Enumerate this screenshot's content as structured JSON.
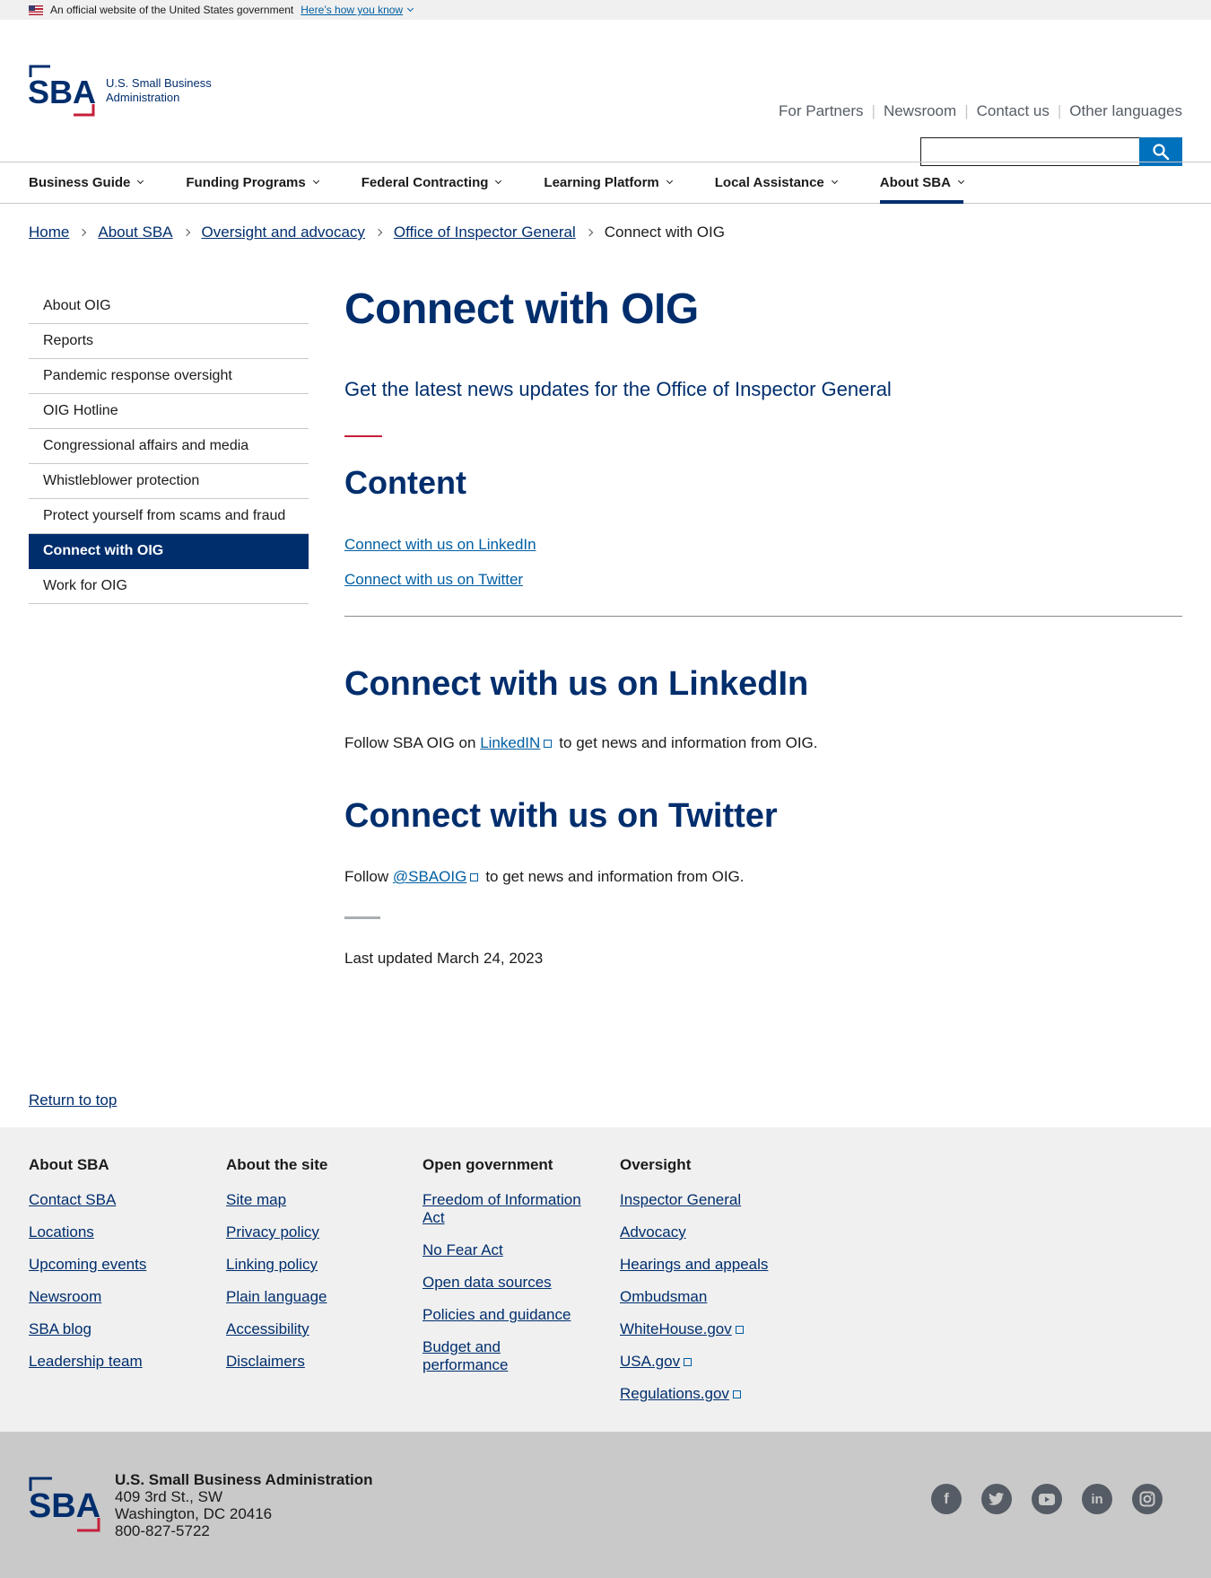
{
  "gov_banner": {
    "text": "An official website of the United States government",
    "link": "Here’s how you know"
  },
  "header": {
    "logo_mark": "SBA",
    "logo_line1": "U.S. Small Business",
    "logo_line2": "Administration",
    "util_nav": [
      "For Partners",
      "Newsroom",
      "Contact us",
      "Other languages"
    ]
  },
  "main_nav": [
    {
      "label": "Business Guide"
    },
    {
      "label": "Funding Programs"
    },
    {
      "label": "Federal Contracting"
    },
    {
      "label": "Learning Platform"
    },
    {
      "label": "Local Assistance"
    },
    {
      "label": "About SBA",
      "active": true
    }
  ],
  "breadcrumb": {
    "links": [
      "Home",
      "About SBA",
      "Oversight and advocacy",
      "Office of Inspector General"
    ],
    "current": "Connect with OIG"
  },
  "sidenav": [
    {
      "label": "About OIG"
    },
    {
      "label": "Reports"
    },
    {
      "label": "Pandemic response oversight"
    },
    {
      "label": "OIG Hotline"
    },
    {
      "label": "Congressional affairs and media"
    },
    {
      "label": "Whistleblower protection"
    },
    {
      "label": "Protect yourself from scams and fraud"
    },
    {
      "label": "Connect with OIG",
      "active": true
    },
    {
      "label": "Work for OIG"
    }
  ],
  "content": {
    "title": "Connect with OIG",
    "lede": "Get the latest news updates for the Office of Inspector General",
    "content_heading": "Content",
    "toc": [
      "Connect with us on LinkedIn",
      "Connect with us on Twitter"
    ],
    "linkedin_heading": "Connect with us on LinkedIn",
    "linkedin_pre": "Follow SBA OIG on ",
    "linkedin_link": "LinkedIN",
    "linkedin_post": "to get news and information from OIG.",
    "twitter_heading": "Connect with us on Twitter",
    "twitter_pre": "Follow ",
    "twitter_link": "@SBAOIG",
    "twitter_post": "to get news and information from OIG.",
    "last_updated": "Last updated March 24, 2023"
  },
  "return_top": "Return to top",
  "footer": {
    "columns": [
      {
        "heading": "About SBA",
        "links": [
          "Contact SBA",
          "Locations",
          "Upcoming events",
          "Newsroom",
          "SBA blog",
          "Leadership team"
        ]
      },
      {
        "heading": "About the site",
        "links": [
          "Site map",
          "Privacy policy",
          "Linking policy",
          "Plain language",
          "Accessibility",
          "Disclaimers"
        ]
      },
      {
        "heading": "Open government",
        "links": [
          "Freedom of Information Act",
          "No Fear Act",
          "Open data sources",
          "Policies and guidance",
          "Budget and performance"
        ]
      },
      {
        "heading": "Oversight",
        "links": [
          "Inspector General",
          "Advocacy",
          "Hearings and appeals",
          "Ombudsman",
          "WhiteHouse.gov",
          "USA.gov",
          "Regulations.gov"
        ]
      }
    ]
  },
  "bottom": {
    "org": "U.S. Small Business Administration",
    "street": "409 3rd St., SW",
    "city": "Washington, DC 20416",
    "phone": "800-827-5722",
    "social": [
      "facebook-icon",
      "twitter-icon",
      "youtube-icon",
      "linkedin-icon",
      "instagram-icon"
    ]
  },
  "colors": {
    "primary": "#002e6d",
    "accent_red": "#c5203a",
    "link": "#005ea2",
    "search_btn": "#0071bc"
  }
}
